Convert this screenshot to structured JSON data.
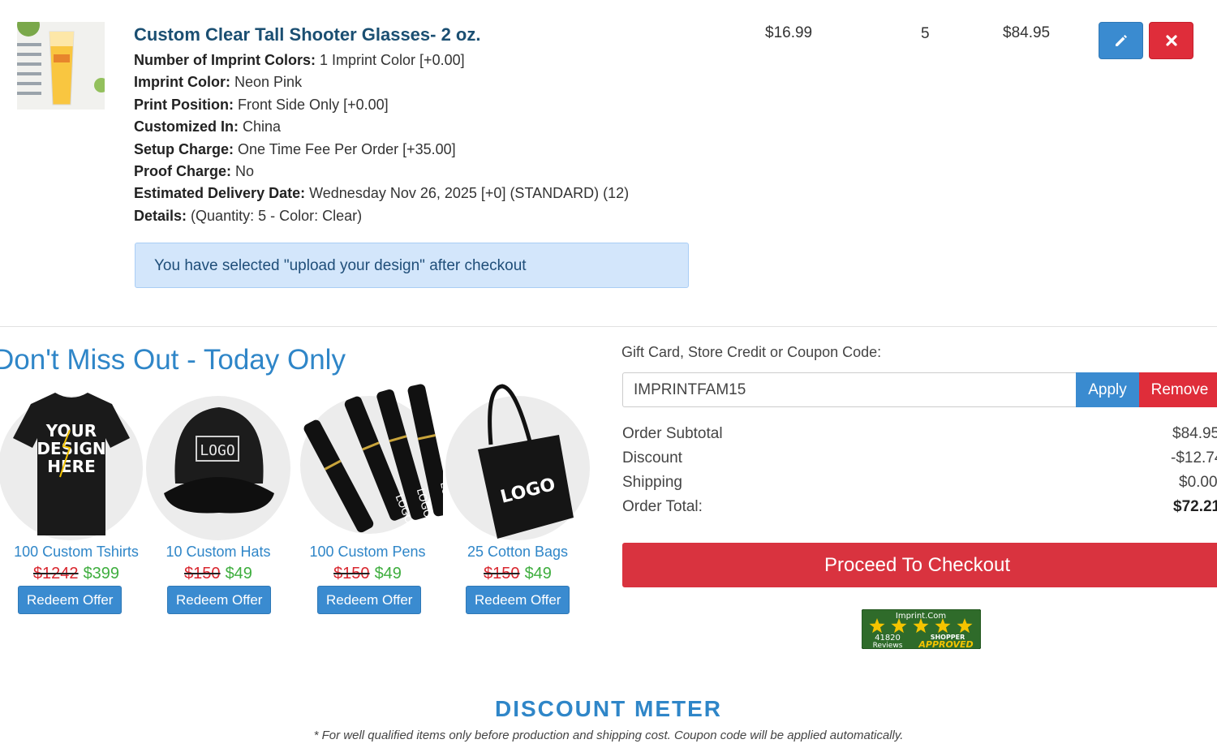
{
  "cart_item": {
    "title": "Custom Clear Tall Shooter Glasses- 2 oz.",
    "attributes": [
      {
        "label": "Number of Imprint Colors:",
        "value": "1 Imprint Color [+0.00]"
      },
      {
        "label": "Imprint Color:",
        "value": "Neon Pink"
      },
      {
        "label": "Print Position:",
        "value": "Front Side Only [+0.00]"
      },
      {
        "label": "Customized In:",
        "value": "China"
      },
      {
        "label": "Setup Charge:",
        "value": "One Time Fee Per Order [+35.00]"
      },
      {
        "label": "Proof Charge:",
        "value": "No"
      },
      {
        "label": "Estimated Delivery Date:",
        "value": "Wednesday Nov 26, 2025 [+0] (STANDARD) (12)"
      },
      {
        "label": "Details:",
        "value": "(Quantity: 5 - Color: Clear)"
      }
    ],
    "unit_price": "$16.99",
    "quantity": "5",
    "line_total": "$84.95",
    "upload_notice": "You have selected \"upload your design\" after checkout",
    "edit_icon": "pencil-icon",
    "remove_icon": "close-icon"
  },
  "offers": {
    "title": "Don't Miss Out - Today Only",
    "items": [
      {
        "name": "100 Custom Tshirts",
        "old_price": "$1242",
        "new_price": "$399",
        "button": "Redeem Offer",
        "art": "tshirt-image"
      },
      {
        "name": "10 Custom Hats",
        "old_price": "$150",
        "new_price": "$49",
        "button": "Redeem Offer",
        "art": "hat-image"
      },
      {
        "name": "100 Custom Pens",
        "old_price": "$150",
        "new_price": "$49",
        "button": "Redeem Offer",
        "art": "pens-image"
      },
      {
        "name": "25 Cotton Bags",
        "old_price": "$150",
        "new_price": "$49",
        "button": "Redeem Offer",
        "art": "bag-image"
      }
    ],
    "tshirt_text": [
      "YOUR",
      "DESIGN",
      "HERE"
    ],
    "logo_text": "LOGO"
  },
  "coupon": {
    "label": "Gift Card, Store Credit or Coupon Code:",
    "value": "IMPRINTFAM15",
    "apply": "Apply",
    "remove": "Remove"
  },
  "totals": {
    "rows": [
      {
        "label": "Order Subtotal",
        "value": "$84.95"
      },
      {
        "label": "Discount",
        "value": "-$12.74"
      },
      {
        "label": "Shipping",
        "value": "$0.00"
      },
      {
        "label": "Order Total:",
        "value": "$72.21"
      }
    ]
  },
  "checkout": {
    "label": "Proceed To Checkout"
  },
  "badge": {
    "site": "Imprint.Com",
    "reviews_count": "41820",
    "reviews_word": "Reviews",
    "approved_top": "SHOPPER",
    "approved_bottom": "APPROVED",
    "rating_stars": 5
  },
  "discount_meter": {
    "title": "DISCOUNT METER",
    "note": "* For well qualified items only before production and shipping cost. Coupon code will be applied automatically."
  },
  "colors": {
    "primary_blue": "#3a8bd0",
    "danger_red": "#df2d3a",
    "title_blue": "#2f86c8",
    "new_price_green": "#3fae3f"
  }
}
